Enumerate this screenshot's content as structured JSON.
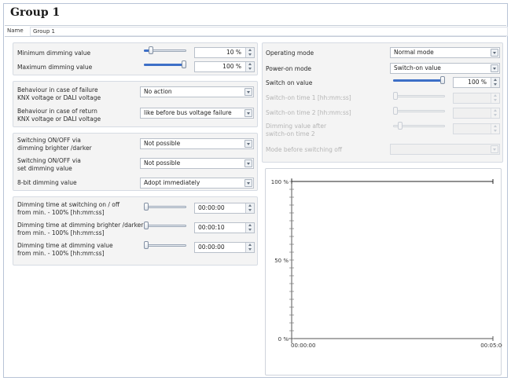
{
  "title": "Group 1",
  "name_label": "Name",
  "name_value": "Group 1",
  "left": {
    "min_dimming_label": "Minimum dimming value",
    "min_dimming_value": "10 %",
    "min_dimming_level": 0.12,
    "max_dimming_label": "Maximum dimming value",
    "max_dimming_value": "100 %",
    "max_dimming_level": 1.0,
    "behaviour_failure_label": "Behaviour in case of failure\nKNX voltage or DALI voltage",
    "behaviour_failure_value": "No action",
    "behaviour_return_label": "Behaviour in case of return\nKNX voltage or DALI voltage",
    "behaviour_return_value": "like before bus voltage failure",
    "switch_brighter_label": "Switching ON/OFF via\ndimming brighter /darker",
    "switch_brighter_value": "Not possible",
    "switch_set_label": "Switching ON/OFF via\nset dimming value",
    "switch_set_value": "Not possible",
    "eight_bit_label": "8-bit dimming value",
    "eight_bit_value": "Adopt immediately",
    "time_switch_label": "Dimming time at switching on / off\nfrom min. - 100% [hh:mm:ss]",
    "time_switch_value": "00:00:00",
    "time_switch_level": 0.0,
    "time_brighter_label": "Dimming time at dimming brighter /darker\nfrom min. - 100% [hh:mm:ss]",
    "time_brighter_value": "00:00:10",
    "time_brighter_level": 0.0,
    "time_value_label": "Dimming time at dimming value\nfrom min. - 100% [hh:mm:ss]",
    "time_value_value": "00:00:00",
    "time_value_level": 0.0
  },
  "right": {
    "operating_mode_label": "Operating mode",
    "operating_mode_value": "Normal mode",
    "power_on_label": "Power-on mode",
    "power_on_value": "Switch-on value",
    "switch_on_label": "Switch on value",
    "switch_on_value": "100 %",
    "switch_on_level": 1.0,
    "switch_on_time1_label": "Switch-on time 1 [hh:mm:ss]",
    "switch_on_time1_level": 0.0,
    "switch_on_time2_label": "Switch-on time 2 [hh:mm:ss]",
    "switch_on_time2_level": 0.0,
    "dimming_after_label": "Dimming value after\nswitch-on time 2",
    "dimming_after_level": 0.1,
    "mode_before_label": "Mode before switching off",
    "colors": {
      "accent": "#3d6fc7",
      "disabled_text": "#b5b5b5"
    }
  },
  "chart_data": {
    "type": "line",
    "y_tick_labels": [
      "100 %",
      "50 %",
      "0 %"
    ],
    "x_tick_labels": [
      "00:00:00",
      "00:05:00"
    ],
    "ylim": [
      0,
      100
    ],
    "series": [
      {
        "x": [
          0,
          300
        ],
        "y": [
          100,
          100
        ]
      }
    ]
  }
}
